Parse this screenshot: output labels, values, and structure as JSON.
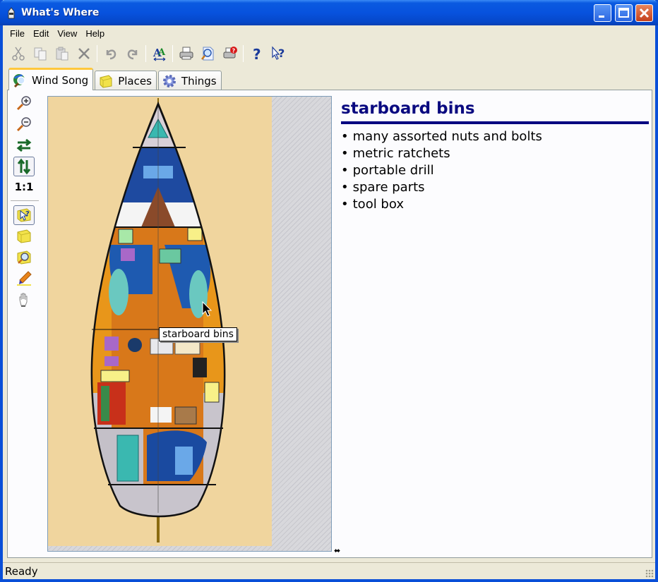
{
  "window": {
    "title": "What's Where",
    "controls": {
      "minimize": "minimize",
      "maximize": "maximize",
      "close": "close"
    }
  },
  "menu": [
    "File",
    "Edit",
    "View",
    "Help"
  ],
  "toolbar": {
    "buttons": [
      {
        "name": "cut",
        "icon": "scissors-icon",
        "enabled": false
      },
      {
        "name": "copy",
        "icon": "copy-icon",
        "enabled": false
      },
      {
        "name": "paste",
        "icon": "paste-icon",
        "enabled": false
      },
      {
        "name": "delete",
        "icon": "x-icon",
        "enabled": false
      },
      {
        "name": "undo",
        "icon": "undo-icon",
        "enabled": false
      },
      {
        "name": "redo",
        "icon": "redo-icon",
        "enabled": false
      },
      {
        "name": "font",
        "icon": "font-icon",
        "enabled": true
      },
      {
        "name": "print",
        "icon": "printer-icon",
        "enabled": true
      },
      {
        "name": "print-preview",
        "icon": "print-preview-icon",
        "enabled": true
      },
      {
        "name": "print-help",
        "icon": "printer-question-icon",
        "enabled": true
      },
      {
        "name": "help",
        "icon": "question-icon",
        "enabled": true
      },
      {
        "name": "whats-this",
        "icon": "arrow-question-icon",
        "enabled": true
      }
    ]
  },
  "tabs": [
    {
      "label": "Wind Song",
      "icon": "globe-magnifier-icon",
      "active": true
    },
    {
      "label": "Places",
      "icon": "yellow-box-icon",
      "active": false
    },
    {
      "label": "Things",
      "icon": "gear-icon",
      "active": false
    }
  ],
  "side_tools": {
    "zoom_in": "zoom-in",
    "zoom_out": "zoom-out",
    "fit_width": "fit-width",
    "fit_height": "fit-height",
    "actual_size_label": "1:1",
    "identify": "identify-place",
    "new_place": "new-place",
    "find_place": "find-place",
    "highlight": "highlight",
    "pan": "pan"
  },
  "map": {
    "name": "Wind Song",
    "tooltip": "starboard bins"
  },
  "detail": {
    "title": "starboard bins",
    "items": [
      "many assorted nuts and bolts",
      "metric ratchets",
      "portable drill",
      "spare parts",
      "tool box"
    ]
  },
  "colors": {
    "title_accent": "#000080",
    "titlebar": "#0752de",
    "tab_active_highlight": "#ffc83c"
  },
  "status": {
    "text": "Ready"
  }
}
